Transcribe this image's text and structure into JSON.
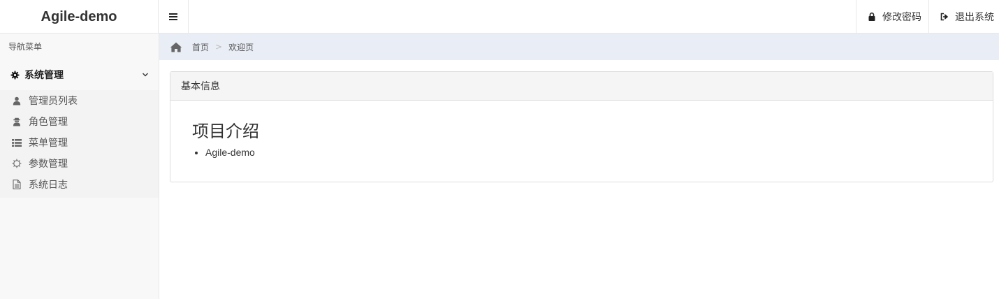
{
  "brand": "Agile-demo",
  "header": {
    "change_password": "修改密码",
    "logout": "退出系统"
  },
  "sidebar": {
    "title": "导航菜单",
    "group": {
      "label": "系统管理",
      "icon": "gear-icon",
      "items": [
        {
          "label": "管理员列表",
          "icon": "user-icon"
        },
        {
          "label": "角色管理",
          "icon": "user-secret-icon"
        },
        {
          "label": "菜单管理",
          "icon": "list-icon"
        },
        {
          "label": "参数管理",
          "icon": "gear-outline-icon"
        },
        {
          "label": "系统日志",
          "icon": "file-icon"
        }
      ]
    }
  },
  "breadcrumb": {
    "home": "首页",
    "separator": ">",
    "current": "欢迎页"
  },
  "panel": {
    "heading": "基本信息",
    "title": "项目介绍",
    "items": [
      "Agile-demo"
    ]
  }
}
